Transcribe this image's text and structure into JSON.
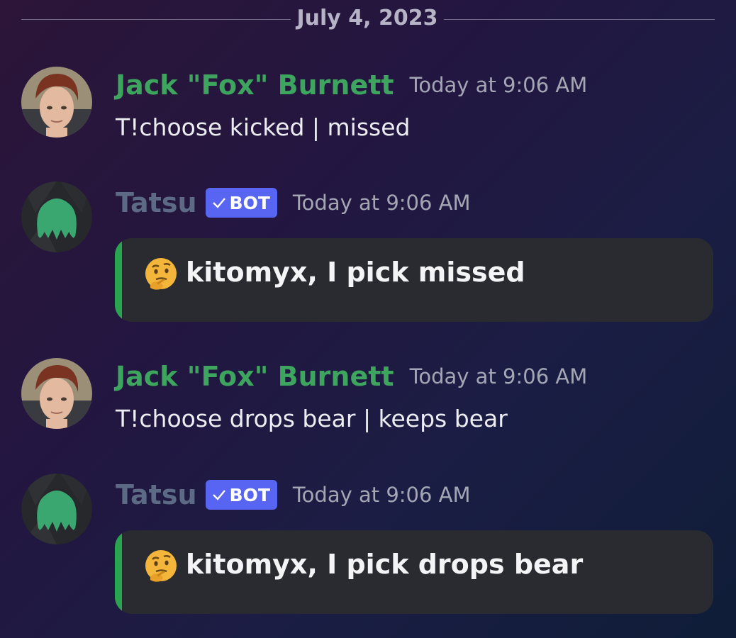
{
  "date_divider": "July 4, 2023",
  "colors": {
    "jack_name": "#3da55d",
    "tatsu_name": "#5c6a86",
    "bot_badge": "#5865f2",
    "embed_bar": "#2aa54f",
    "embed_bg": "#2a2b30"
  },
  "messages": [
    {
      "author": "Jack \"Fox\" Burnett",
      "timestamp": "Today at 9:06 AM",
      "text": "T!choose kicked | missed"
    },
    {
      "author": "Tatsu",
      "badge": "BOT",
      "timestamp": "Today at 9:06 AM",
      "embed_emoji": "thinking-face-icon",
      "embed_text": "kitomyx, I pick missed"
    },
    {
      "author": "Jack \"Fox\" Burnett",
      "timestamp": "Today at 9:06 AM",
      "text": "T!choose drops bear | keeps bear"
    },
    {
      "author": "Tatsu",
      "badge": "BOT",
      "timestamp": "Today at 9:06 AM",
      "embed_emoji": "thinking-face-icon",
      "embed_text": "kitomyx, I pick drops bear"
    }
  ]
}
